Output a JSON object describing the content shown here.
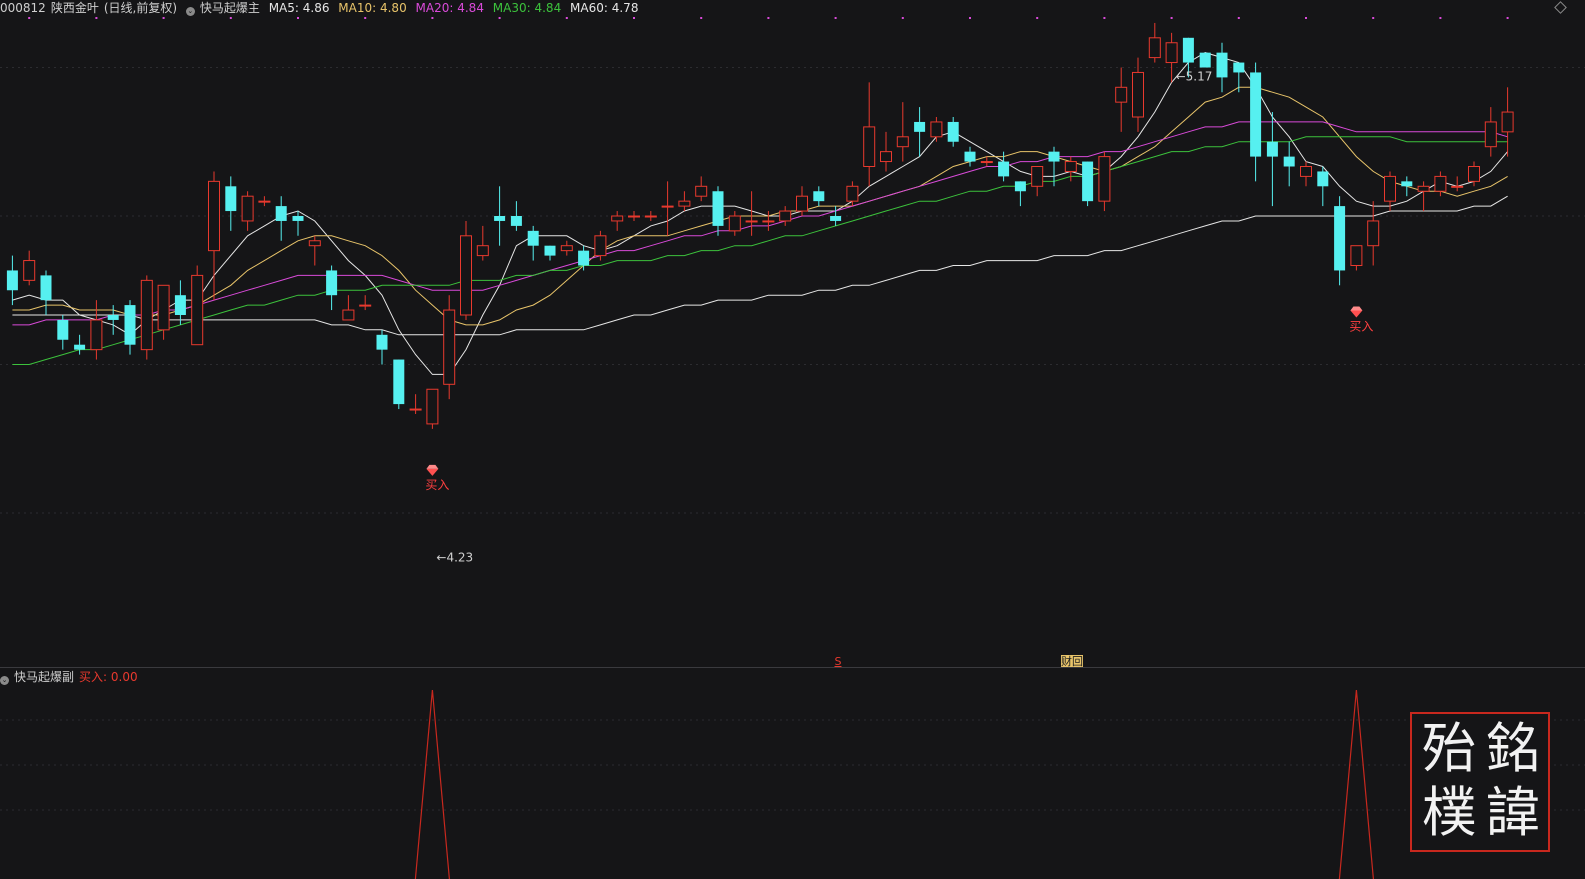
{
  "header": {
    "code": "000812",
    "name": "陕西金叶",
    "period": "(日线,前复权)",
    "indicator": "快马起爆主",
    "ma": [
      {
        "label": "MA5: 4.86",
        "color": "#e6e6e6"
      },
      {
        "label": "MA10: 4.80",
        "color": "#e8c46a"
      },
      {
        "label": "MA20: 4.84",
        "color": "#d94ad9"
      },
      {
        "label": "MA30: 4.84",
        "color": "#3cc23c"
      },
      {
        "label": "MA60: 4.78",
        "color": "#e6e6e6"
      }
    ]
  },
  "sub_header": {
    "name": "快马起爆副",
    "buy_value": "买入: 0.00"
  },
  "annotations": {
    "high": "5.17",
    "low": "4.23",
    "buy": "买入",
    "marker_s": "S",
    "marker_cai": "财",
    "marker_hui": "回"
  },
  "seal": {
    "chars": [
      "銘",
      "諱",
      "殆",
      "樸"
    ]
  },
  "colors": {
    "up": "#e8392e",
    "down": "#56f0f0",
    "background": "#151517",
    "signal": "#c8281e"
  },
  "chart_data": {
    "type": "candlestick",
    "y_range": [
      4.1,
      5.3
    ],
    "dates": [],
    "candles": [
      [
        4.79,
        4.75,
        4.82,
        4.72
      ],
      [
        4.77,
        4.81,
        4.83,
        4.76
      ],
      [
        4.78,
        4.73,
        4.79,
        4.7
      ],
      [
        4.69,
        4.65,
        4.7,
        4.63
      ],
      [
        4.64,
        4.63,
        4.66,
        4.62
      ],
      [
        4.63,
        4.69,
        4.73,
        4.61
      ],
      [
        4.7,
        4.69,
        4.72,
        4.66
      ],
      [
        4.72,
        4.64,
        4.73,
        4.62
      ],
      [
        4.63,
        4.77,
        4.78,
        4.61
      ],
      [
        4.67,
        4.76,
        4.76,
        4.65
      ],
      [
        4.74,
        4.7,
        4.77,
        4.68
      ],
      [
        4.64,
        4.78,
        4.8,
        4.64
      ],
      [
        4.83,
        4.97,
        4.99,
        4.73
      ],
      [
        4.96,
        4.91,
        4.98,
        4.87
      ],
      [
        4.89,
        4.94,
        4.95,
        4.87
      ],
      [
        4.93,
        4.93,
        4.94,
        4.92
      ],
      [
        4.92,
        4.89,
        4.94,
        4.85
      ],
      [
        4.9,
        4.89,
        4.91,
        4.86
      ],
      [
        4.84,
        4.85,
        4.86,
        4.8
      ],
      [
        4.79,
        4.74,
        4.8,
        4.71
      ],
      [
        4.69,
        4.71,
        4.74,
        4.7
      ],
      [
        4.72,
        4.72,
        4.74,
        4.71
      ],
      [
        4.66,
        4.63,
        4.67,
        4.6
      ],
      [
        4.61,
        4.52,
        4.61,
        4.51
      ],
      [
        4.51,
        4.51,
        4.54,
        4.5
      ],
      [
        4.48,
        4.55,
        4.55,
        4.47
      ],
      [
        4.56,
        4.71,
        4.74,
        4.53
      ],
      [
        4.7,
        4.86,
        4.89,
        4.69
      ],
      [
        4.82,
        4.84,
        4.88,
        4.81
      ],
      [
        4.9,
        4.89,
        4.96,
        4.84
      ],
      [
        4.9,
        4.88,
        4.93,
        4.87
      ],
      [
        4.87,
        4.84,
        4.88,
        4.81
      ],
      [
        4.84,
        4.82,
        4.84,
        4.81
      ],
      [
        4.83,
        4.84,
        4.85,
        4.82
      ],
      [
        4.83,
        4.8,
        4.84,
        4.79
      ],
      [
        4.82,
        4.86,
        4.87,
        4.81
      ],
      [
        4.89,
        4.9,
        4.91,
        4.87
      ],
      [
        4.9,
        4.9,
        4.91,
        4.89
      ],
      [
        4.9,
        4.9,
        4.91,
        4.89
      ],
      [
        4.92,
        4.92,
        4.97,
        4.86
      ],
      [
        4.92,
        4.93,
        4.95,
        4.91
      ],
      [
        4.94,
        4.96,
        4.98,
        4.93
      ],
      [
        4.95,
        4.88,
        4.96,
        4.86
      ],
      [
        4.87,
        4.9,
        4.91,
        4.86
      ],
      [
        4.89,
        4.89,
        4.95,
        4.86
      ],
      [
        4.89,
        4.89,
        4.91,
        4.87
      ],
      [
        4.89,
        4.91,
        4.92,
        4.88
      ],
      [
        4.91,
        4.94,
        4.96,
        4.9
      ],
      [
        4.95,
        4.93,
        4.96,
        4.92
      ],
      [
        4.9,
        4.89,
        4.92,
        4.88
      ],
      [
        4.93,
        4.96,
        4.97,
        4.92
      ],
      [
        5.0,
        5.08,
        5.17,
        4.96
      ],
      [
        5.01,
        5.03,
        5.07,
        4.99
      ],
      [
        5.04,
        5.06,
        5.13,
        5.01
      ],
      [
        5.09,
        5.07,
        5.12,
        5.02
      ],
      [
        5.06,
        5.09,
        5.1,
        5.05
      ],
      [
        5.09,
        5.05,
        5.1,
        5.04
      ],
      [
        5.03,
        5.01,
        5.04,
        5.0
      ],
      [
        5.01,
        5.01,
        5.02,
        5.0
      ],
      [
        5.01,
        4.98,
        5.03,
        4.97
      ],
      [
        4.97,
        4.95,
        4.97,
        4.92
      ],
      [
        4.96,
        5.0,
        5.0,
        4.94
      ],
      [
        5.03,
        5.01,
        5.04,
        4.96
      ],
      [
        4.99,
        5.01,
        5.02,
        4.97
      ],
      [
        5.01,
        4.93,
        5.01,
        4.92
      ],
      [
        4.93,
        5.02,
        5.03,
        4.91
      ],
      [
        5.13,
        5.16,
        5.2,
        5.07
      ],
      [
        5.1,
        5.19,
        5.22,
        5.07
      ],
      [
        5.22,
        5.26,
        5.29,
        5.21
      ],
      [
        5.21,
        5.25,
        5.27,
        5.17
      ],
      [
        5.26,
        5.21,
        5.26,
        5.18
      ],
      [
        5.23,
        5.2,
        5.22,
        5.2
      ],
      [
        5.23,
        5.18,
        5.25,
        5.15
      ],
      [
        5.21,
        5.19,
        5.21,
        5.15
      ],
      [
        5.19,
        5.02,
        5.21,
        4.97
      ],
      [
        5.05,
        5.02,
        5.11,
        4.92
      ],
      [
        5.02,
        5.0,
        5.05,
        4.96
      ],
      [
        4.98,
        5.0,
        5.01,
        4.96
      ],
      [
        4.99,
        4.96,
        5.0,
        4.92
      ],
      [
        4.92,
        4.79,
        4.94,
        4.76
      ],
      [
        4.8,
        4.84,
        4.84,
        4.79
      ],
      [
        4.84,
        4.89,
        4.93,
        4.8
      ],
      [
        4.93,
        4.98,
        4.99,
        4.91
      ],
      [
        4.97,
        4.96,
        4.98,
        4.94
      ],
      [
        4.95,
        4.96,
        4.97,
        4.91
      ],
      [
        4.95,
        4.98,
        4.99,
        4.94
      ],
      [
        4.96,
        4.96,
        4.98,
        4.95
      ],
      [
        4.97,
        5.0,
        5.01,
        4.96
      ],
      [
        5.04,
        5.09,
        5.12,
        5.02
      ],
      [
        5.07,
        5.11,
        5.16,
        5.02
      ]
    ],
    "series": [
      {
        "name": "MA5",
        "color": "#e6e6e6",
        "values": [
          4.73,
          4.74,
          4.73,
          4.73,
          4.7,
          4.69,
          4.68,
          4.66,
          4.69,
          4.71,
          4.73,
          4.73,
          4.78,
          4.82,
          4.86,
          4.88,
          4.9,
          4.91,
          4.89,
          4.85,
          4.81,
          4.78,
          4.74,
          4.67,
          4.62,
          4.58,
          4.58,
          4.63,
          4.7,
          4.76,
          4.84,
          4.86,
          4.86,
          4.86,
          4.84,
          4.83,
          4.84,
          4.86,
          4.88,
          4.89,
          4.91,
          4.92,
          4.92,
          4.92,
          4.91,
          4.9,
          4.9,
          4.91,
          4.91,
          4.91,
          4.93,
          4.96,
          4.98,
          5.0,
          5.02,
          5.06,
          5.07,
          5.05,
          5.03,
          5.01,
          4.99,
          4.98,
          4.98,
          4.99,
          4.98,
          4.99,
          5.02,
          5.06,
          5.11,
          5.17,
          5.21,
          5.23,
          5.22,
          5.21,
          5.16,
          5.1,
          5.06,
          5.01,
          5.0,
          4.96,
          4.93,
          4.92,
          4.92,
          4.93,
          4.95,
          4.97,
          4.96,
          4.97,
          4.99,
          5.03
        ]
      },
      {
        "name": "MA10",
        "color": "#e8c46a",
        "values": [
          4.71,
          4.71,
          4.72,
          4.72,
          4.71,
          4.71,
          4.71,
          4.7,
          4.7,
          4.7,
          4.71,
          4.72,
          4.74,
          4.76,
          4.79,
          4.81,
          4.83,
          4.85,
          4.86,
          4.86,
          4.85,
          4.84,
          4.82,
          4.79,
          4.75,
          4.72,
          4.69,
          4.68,
          4.68,
          4.69,
          4.71,
          4.72,
          4.74,
          4.77,
          4.8,
          4.83,
          4.85,
          4.86,
          4.86,
          4.86,
          4.87,
          4.88,
          4.89,
          4.9,
          4.9,
          4.9,
          4.91,
          4.91,
          4.92,
          4.92,
          4.92,
          4.93,
          4.94,
          4.95,
          4.96,
          4.98,
          5.0,
          5.01,
          5.02,
          5.02,
          5.03,
          5.03,
          5.02,
          5.01,
          5.0,
          4.99,
          5.0,
          5.02,
          5.04,
          5.07,
          5.1,
          5.13,
          5.14,
          5.16,
          5.16,
          5.15,
          5.14,
          5.12,
          5.1,
          5.06,
          5.02,
          4.99,
          4.97,
          4.96,
          4.95,
          4.95,
          4.94,
          4.95,
          4.96,
          4.98
        ]
      },
      {
        "name": "MA20",
        "color": "#d94ad9",
        "values": [
          4.68,
          4.68,
          4.69,
          4.69,
          4.69,
          4.69,
          4.7,
          4.7,
          4.7,
          4.71,
          4.71,
          4.72,
          4.73,
          4.74,
          4.75,
          4.76,
          4.77,
          4.78,
          4.78,
          4.78,
          4.78,
          4.78,
          4.78,
          4.77,
          4.76,
          4.75,
          4.75,
          4.75,
          4.75,
          4.76,
          4.77,
          4.78,
          4.79,
          4.8,
          4.81,
          4.82,
          4.83,
          4.83,
          4.84,
          4.85,
          4.86,
          4.86,
          4.87,
          4.87,
          4.88,
          4.88,
          4.89,
          4.9,
          4.9,
          4.91,
          4.92,
          4.93,
          4.94,
          4.95,
          4.96,
          4.97,
          4.98,
          4.99,
          5.0,
          5.0,
          5.01,
          5.01,
          5.02,
          5.02,
          5.02,
          5.03,
          5.03,
          5.04,
          5.05,
          5.06,
          5.07,
          5.08,
          5.08,
          5.09,
          5.09,
          5.09,
          5.09,
          5.09,
          5.09,
          5.08,
          5.07,
          5.07,
          5.07,
          5.07,
          5.07,
          5.07,
          5.07,
          5.07,
          5.07,
          5.06
        ]
      },
      {
        "name": "MA30",
        "color": "#3cc23c",
        "values": [
          4.6,
          4.6,
          4.61,
          4.62,
          4.63,
          4.63,
          4.64,
          4.65,
          4.66,
          4.67,
          4.68,
          4.69,
          4.7,
          4.71,
          4.72,
          4.72,
          4.73,
          4.74,
          4.74,
          4.75,
          4.75,
          4.75,
          4.76,
          4.76,
          4.76,
          4.76,
          4.76,
          4.77,
          4.77,
          4.77,
          4.78,
          4.78,
          4.79,
          4.79,
          4.8,
          4.8,
          4.81,
          4.81,
          4.81,
          4.82,
          4.82,
          4.83,
          4.83,
          4.84,
          4.84,
          4.85,
          4.86,
          4.86,
          4.87,
          4.88,
          4.89,
          4.9,
          4.91,
          4.92,
          4.93,
          4.93,
          4.94,
          4.95,
          4.95,
          4.96,
          4.96,
          4.97,
          4.97,
          4.98,
          4.98,
          4.99,
          5.0,
          5.01,
          5.02,
          5.03,
          5.03,
          5.04,
          5.04,
          5.05,
          5.05,
          5.05,
          5.05,
          5.06,
          5.06,
          5.06,
          5.06,
          5.06,
          5.06,
          5.05,
          5.05,
          5.05,
          5.05,
          5.05,
          5.05,
          5.05
        ]
      },
      {
        "name": "MA60",
        "color": "#e6e6e6",
        "values": [
          4.7,
          4.7,
          4.7,
          4.7,
          4.7,
          4.7,
          4.7,
          4.7,
          4.69,
          4.69,
          4.69,
          4.69,
          4.69,
          4.69,
          4.69,
          4.69,
          4.69,
          4.69,
          4.69,
          4.68,
          4.68,
          4.67,
          4.67,
          4.66,
          4.66,
          4.66,
          4.66,
          4.66,
          4.66,
          4.66,
          4.67,
          4.67,
          4.67,
          4.67,
          4.67,
          4.68,
          4.69,
          4.7,
          4.7,
          4.71,
          4.72,
          4.72,
          4.73,
          4.73,
          4.73,
          4.74,
          4.74,
          4.74,
          4.75,
          4.75,
          4.76,
          4.76,
          4.77,
          4.78,
          4.79,
          4.79,
          4.8,
          4.8,
          4.81,
          4.81,
          4.81,
          4.81,
          4.82,
          4.82,
          4.82,
          4.83,
          4.83,
          4.84,
          4.85,
          4.86,
          4.87,
          4.88,
          4.89,
          4.89,
          4.9,
          4.9,
          4.9,
          4.9,
          4.9,
          4.9,
          4.9,
          4.9,
          4.91,
          4.91,
          4.91,
          4.91,
          4.91,
          4.92,
          4.92,
          4.94
        ]
      }
    ],
    "buy_signals": [
      25,
      80
    ],
    "high_marker": {
      "index": 69,
      "value": 5.17
    },
    "low_marker": {
      "index": 25,
      "value": 4.23
    }
  }
}
